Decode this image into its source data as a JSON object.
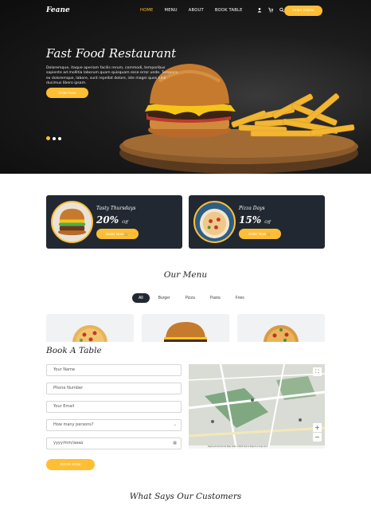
{
  "brand": "Feane",
  "nav": {
    "links": [
      "HOME",
      "MENU",
      "ABOUT",
      "BOOK TABLE"
    ],
    "active_index": 0,
    "icons": [
      "user-icon",
      "cart-icon",
      "search-icon"
    ],
    "order_button": "Order Online"
  },
  "hero": {
    "title": "Fast Food Restaurant",
    "text": "Doloremque, itaque aperiam facilis rerum, commodi, temporibus sapiente ad mollitia laborum quam quisquam esse error unde. Tempora ex doloremque, labore, sunt repellat dolore, iste magni quos nihil ducimus libero ipsam.",
    "button": "Order Now",
    "slides_total": 3,
    "active_slide": 1
  },
  "offers": [
    {
      "name": "Tasty Thursdays",
      "percent": "20%",
      "suffix": "Off",
      "button": "Order Now"
    },
    {
      "name": "Pizza Days",
      "percent": "15%",
      "suffix": "Off",
      "button": "Order Now"
    }
  ],
  "menu": {
    "title": "Our Menu",
    "filters": [
      "All",
      "Burger",
      "Pizza",
      "Pasta",
      "Fries"
    ],
    "active_filter": 0
  },
  "book": {
    "title": "Book A Table",
    "name_placeholder": "Your Name",
    "phone_placeholder": "Phone Number",
    "email_placeholder": "Your Email",
    "persons_placeholder": "How many persons?",
    "date_placeholder": "yyyy/mm/dd",
    "date_display": "yyyy/mm/aaaa",
    "button": "BOOK NOW"
  },
  "map": {
    "attribution": "Keyboard shortcuts   Map data ©2024   Terms   Report a map error"
  },
  "customers": {
    "title": "What Says Our Customers"
  },
  "colors": {
    "accent": "#ffbe33",
    "dark": "#222831"
  }
}
